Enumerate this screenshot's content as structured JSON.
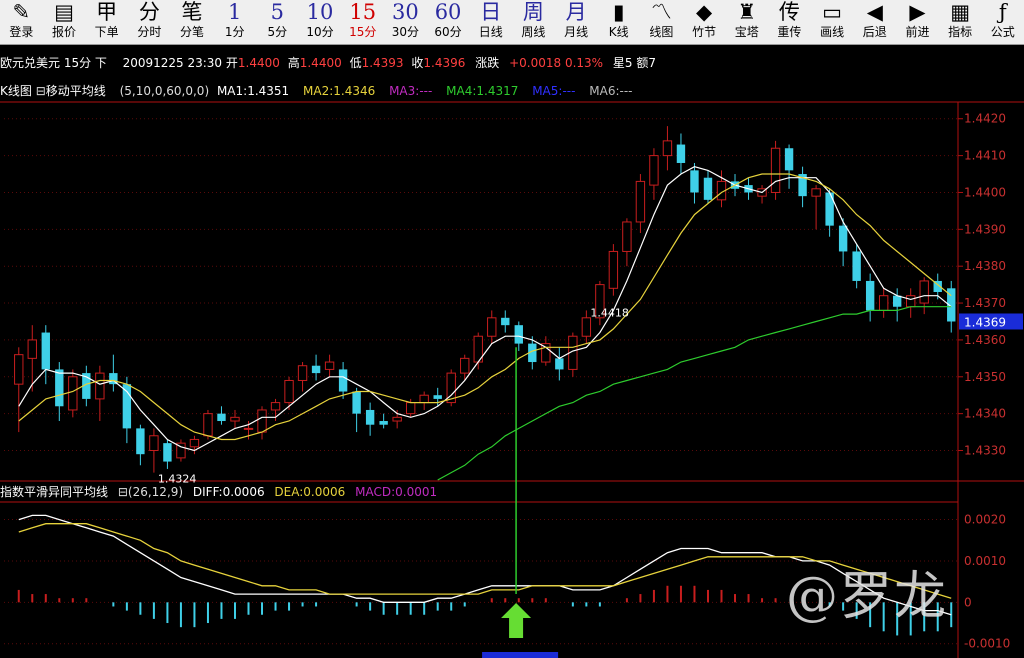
{
  "toolbar": [
    {
      "icon": "✎",
      "label": "登录",
      "name": "login"
    },
    {
      "icon": "▤",
      "label": "报价",
      "name": "quote"
    },
    {
      "icon": "甲",
      "label": "下单",
      "name": "order"
    },
    {
      "icon": "分",
      "label": "分时",
      "name": "intraday"
    },
    {
      "icon": "笔",
      "label": "分笔",
      "name": "tick"
    },
    {
      "icon": "1",
      "label": "1分",
      "name": "1min",
      "num": true
    },
    {
      "icon": "5",
      "label": "5分",
      "name": "5min",
      "num": true
    },
    {
      "icon": "10",
      "label": "10分",
      "name": "10min",
      "num": true
    },
    {
      "icon": "15",
      "label": "15分",
      "name": "15min",
      "num": true,
      "active": true
    },
    {
      "icon": "30",
      "label": "30分",
      "name": "30min",
      "num": true
    },
    {
      "icon": "60",
      "label": "60分",
      "name": "60min",
      "num": true
    },
    {
      "icon": "日",
      "label": "日线",
      "name": "daily",
      "num": true
    },
    {
      "icon": "周",
      "label": "周线",
      "name": "weekly",
      "num": true
    },
    {
      "icon": "月",
      "label": "月线",
      "name": "monthly",
      "num": true
    },
    {
      "icon": "▮",
      "label": "K线",
      "name": "kline"
    },
    {
      "icon": "〽",
      "label": "线图",
      "name": "line"
    },
    {
      "icon": "◆",
      "label": "竹节",
      "name": "bamboo"
    },
    {
      "icon": "♜",
      "label": "宝塔",
      "name": "tower"
    },
    {
      "icon": "传",
      "label": "重传",
      "name": "reload"
    },
    {
      "icon": "▭",
      "label": "画线",
      "name": "draw"
    },
    {
      "icon": "◀",
      "label": "后退",
      "name": "back"
    },
    {
      "icon": "▶",
      "label": "前进",
      "name": "forward"
    },
    {
      "icon": "▦",
      "label": "指标",
      "name": "indicator"
    },
    {
      "icon": "ƒ",
      "label": "公式",
      "name": "formula"
    }
  ],
  "titlebar": {
    "symbol": "欧元兑美元 15分 下",
    "datetime": "20091225 23:30",
    "open_label": "开",
    "open": "1.4400",
    "high_label": "高",
    "high": "1.4400",
    "low_label": "低",
    "low": "1.4393",
    "close_label": "收",
    "close": "1.4396",
    "change_label": "涨跌",
    "change": "+0.0018 0.13%",
    "weekday": "星5",
    "volume": "额7"
  },
  "ma_bar": {
    "kline_label": "K线图",
    "indicator": "移动平均线",
    "params": "(5,10,0,60,0,0)",
    "ma1": "MA1:1.4351",
    "ma2": "MA2:1.4346",
    "ma3": "MA3:---",
    "ma4": "MA4:1.4317",
    "ma5": "MA5:---",
    "ma6": "MA6:---"
  },
  "macd_bar": {
    "indicator": "指数平滑异同平均线",
    "params": "(26,12,9)",
    "diff": "DIFF:0.0006",
    "dea": "DEA:0.0006",
    "macd": "MACD:0.0001"
  },
  "watermark": "@罗龙",
  "colors": {
    "up": "#c81e1e",
    "down": "#3fd0e8",
    "ma1": "#ffffff",
    "ma2": "#e6d23c",
    "ma4": "#2ecc2e",
    "ma3": "#c02cc0",
    "ma5": "#3030ff",
    "ma6": "#bbbbbb",
    "axis": "#b01010",
    "arrow": "#66dd33"
  },
  "chart_data": [
    {
      "type": "candlestick",
      "title": "欧元兑美元 15分",
      "ylim": [
        1.4322,
        1.4424
      ],
      "y_ticks": [
        1.442,
        1.441,
        1.44,
        1.439,
        1.438,
        1.437,
        1.436,
        1.435,
        1.434,
        1.433
      ],
      "last_price_label": "1.4369",
      "annotations": [
        {
          "text": "1.4418",
          "bar": 42
        },
        {
          "text": "1.4324",
          "bar": 10
        }
      ],
      "candles": [
        {
          "o": 1.4348,
          "h": 1.4358,
          "l": 1.4335,
          "c": 1.4356
        },
        {
          "o": 1.4355,
          "h": 1.4364,
          "l": 1.4346,
          "c": 1.436
        },
        {
          "o": 1.4362,
          "h": 1.4364,
          "l": 1.4348,
          "c": 1.4352
        },
        {
          "o": 1.4352,
          "h": 1.4354,
          "l": 1.4338,
          "c": 1.4342
        },
        {
          "o": 1.4341,
          "h": 1.4352,
          "l": 1.4339,
          "c": 1.435
        },
        {
          "o": 1.4351,
          "h": 1.4353,
          "l": 1.4342,
          "c": 1.4344
        },
        {
          "o": 1.4344,
          "h": 1.4353,
          "l": 1.4338,
          "c": 1.4351
        },
        {
          "o": 1.4351,
          "h": 1.4356,
          "l": 1.4346,
          "c": 1.4348
        },
        {
          "o": 1.4348,
          "h": 1.435,
          "l": 1.4332,
          "c": 1.4336
        },
        {
          "o": 1.4336,
          "h": 1.4337,
          "l": 1.4326,
          "c": 1.4329
        },
        {
          "o": 1.433,
          "h": 1.4336,
          "l": 1.4324,
          "c": 1.4334
        },
        {
          "o": 1.4332,
          "h": 1.4333,
          "l": 1.4325,
          "c": 1.4327
        },
        {
          "o": 1.4328,
          "h": 1.4333,
          "l": 1.4327,
          "c": 1.4332
        },
        {
          "o": 1.4331,
          "h": 1.4334,
          "l": 1.4329,
          "c": 1.4333
        },
        {
          "o": 1.4334,
          "h": 1.4341,
          "l": 1.4333,
          "c": 1.434
        },
        {
          "o": 1.434,
          "h": 1.4342,
          "l": 1.4337,
          "c": 1.4338
        },
        {
          "o": 1.4338,
          "h": 1.4341,
          "l": 1.4336,
          "c": 1.4339
        },
        {
          "o": 1.4336,
          "h": 1.4338,
          "l": 1.4333,
          "c": 1.4336
        },
        {
          "o": 1.4335,
          "h": 1.4342,
          "l": 1.4333,
          "c": 1.4341
        },
        {
          "o": 1.4341,
          "h": 1.4344,
          "l": 1.4338,
          "c": 1.4343
        },
        {
          "o": 1.4343,
          "h": 1.435,
          "l": 1.4341,
          "c": 1.4349
        },
        {
          "o": 1.4349,
          "h": 1.4354,
          "l": 1.4346,
          "c": 1.4353
        },
        {
          "o": 1.4353,
          "h": 1.4356,
          "l": 1.4349,
          "c": 1.4351
        },
        {
          "o": 1.4352,
          "h": 1.4356,
          "l": 1.435,
          "c": 1.4354
        },
        {
          "o": 1.4352,
          "h": 1.4354,
          "l": 1.4344,
          "c": 1.4346
        },
        {
          "o": 1.4346,
          "h": 1.4347,
          "l": 1.4335,
          "c": 1.434
        },
        {
          "o": 1.4341,
          "h": 1.4343,
          "l": 1.4334,
          "c": 1.4337
        },
        {
          "o": 1.4338,
          "h": 1.434,
          "l": 1.4336,
          "c": 1.4337
        },
        {
          "o": 1.4338,
          "h": 1.4341,
          "l": 1.4336,
          "c": 1.4339
        },
        {
          "o": 1.434,
          "h": 1.4344,
          "l": 1.4339,
          "c": 1.4343
        },
        {
          "o": 1.4343,
          "h": 1.4346,
          "l": 1.4341,
          "c": 1.4345
        },
        {
          "o": 1.4345,
          "h": 1.4347,
          "l": 1.4342,
          "c": 1.4344
        },
        {
          "o": 1.4343,
          "h": 1.4352,
          "l": 1.4342,
          "c": 1.4351
        },
        {
          "o": 1.4351,
          "h": 1.4356,
          "l": 1.4349,
          "c": 1.4355
        },
        {
          "o": 1.4354,
          "h": 1.4362,
          "l": 1.4352,
          "c": 1.4361
        },
        {
          "o": 1.4361,
          "h": 1.4368,
          "l": 1.4359,
          "c": 1.4366
        },
        {
          "o": 1.4366,
          "h": 1.4368,
          "l": 1.4362,
          "c": 1.4364
        },
        {
          "o": 1.4364,
          "h": 1.4365,
          "l": 1.4357,
          "c": 1.4359
        },
        {
          "o": 1.4359,
          "h": 1.4361,
          "l": 1.4352,
          "c": 1.4354
        },
        {
          "o": 1.4354,
          "h": 1.4361,
          "l": 1.4353,
          "c": 1.4359
        },
        {
          "o": 1.4355,
          "h": 1.4358,
          "l": 1.4349,
          "c": 1.4352
        },
        {
          "o": 1.4352,
          "h": 1.4362,
          "l": 1.435,
          "c": 1.4361
        },
        {
          "o": 1.4361,
          "h": 1.4368,
          "l": 1.4359,
          "c": 1.4366
        },
        {
          "o": 1.4366,
          "h": 1.4376,
          "l": 1.4364,
          "c": 1.4375
        },
        {
          "o": 1.4374,
          "h": 1.4386,
          "l": 1.4372,
          "c": 1.4384
        },
        {
          "o": 1.4384,
          "h": 1.4393,
          "l": 1.438,
          "c": 1.4392
        },
        {
          "o": 1.4392,
          "h": 1.4405,
          "l": 1.4389,
          "c": 1.4403
        },
        {
          "o": 1.4402,
          "h": 1.4412,
          "l": 1.4398,
          "c": 1.441
        },
        {
          "o": 1.441,
          "h": 1.4418,
          "l": 1.4406,
          "c": 1.4414
        },
        {
          "o": 1.4413,
          "h": 1.4416,
          "l": 1.4405,
          "c": 1.4408
        },
        {
          "o": 1.4406,
          "h": 1.4408,
          "l": 1.4397,
          "c": 1.44
        },
        {
          "o": 1.4404,
          "h": 1.4406,
          "l": 1.4397,
          "c": 1.4398
        },
        {
          "o": 1.4398,
          "h": 1.4406,
          "l": 1.4396,
          "c": 1.4403
        },
        {
          "o": 1.4403,
          "h": 1.4405,
          "l": 1.4399,
          "c": 1.4401
        },
        {
          "o": 1.4402,
          "h": 1.4404,
          "l": 1.4398,
          "c": 1.44
        },
        {
          "o": 1.4399,
          "h": 1.4402,
          "l": 1.4397,
          "c": 1.4401
        },
        {
          "o": 1.44,
          "h": 1.4414,
          "l": 1.4398,
          "c": 1.4412
        },
        {
          "o": 1.4412,
          "h": 1.4413,
          "l": 1.4401,
          "c": 1.4406
        },
        {
          "o": 1.4405,
          "h": 1.4407,
          "l": 1.4396,
          "c": 1.4399
        },
        {
          "o": 1.4399,
          "h": 1.4402,
          "l": 1.439,
          "c": 1.4401
        },
        {
          "o": 1.44,
          "h": 1.4401,
          "l": 1.4388,
          "c": 1.4391
        },
        {
          "o": 1.4391,
          "h": 1.4393,
          "l": 1.438,
          "c": 1.4384
        },
        {
          "o": 1.4384,
          "h": 1.4386,
          "l": 1.4374,
          "c": 1.4376
        },
        {
          "o": 1.4376,
          "h": 1.4378,
          "l": 1.4365,
          "c": 1.4368
        },
        {
          "o": 1.4368,
          "h": 1.4374,
          "l": 1.4366,
          "c": 1.4372
        },
        {
          "o": 1.4372,
          "h": 1.4374,
          "l": 1.4365,
          "c": 1.4369
        },
        {
          "o": 1.4369,
          "h": 1.4374,
          "l": 1.4366,
          "c": 1.4372
        },
        {
          "o": 1.437,
          "h": 1.4377,
          "l": 1.4367,
          "c": 1.4376
        },
        {
          "o": 1.4376,
          "h": 1.4378,
          "l": 1.4371,
          "c": 1.4373
        },
        {
          "o": 1.4374,
          "h": 1.4376,
          "l": 1.4362,
          "c": 1.4365
        }
      ],
      "ma_series": [
        {
          "name": "MA1",
          "values": [
            1.4342,
            1.4348,
            1.4352,
            1.4351,
            1.4351,
            1.435,
            1.4348,
            1.4349,
            1.4346,
            1.4341,
            1.4337,
            1.4333,
            1.4331,
            1.433,
            1.4332,
            1.4334,
            1.4336,
            1.4337,
            1.4339,
            1.4339,
            1.4342,
            1.4345,
            1.4348,
            1.435,
            1.435,
            1.4348,
            1.4346,
            1.4343,
            1.434,
            1.4339,
            1.434,
            1.4342,
            1.4345,
            1.4349,
            1.4354,
            1.4359,
            1.4361,
            1.4361,
            1.436,
            1.4358,
            1.4355,
            1.4357,
            1.4358,
            1.4362,
            1.4368,
            1.4376,
            1.4385,
            1.4394,
            1.4402,
            1.4405,
            1.4407,
            1.4406,
            1.4404,
            1.4402,
            1.4401,
            1.44,
            1.4403,
            1.4404,
            1.4404,
            1.4404,
            1.44,
            1.4392,
            1.4386,
            1.438,
            1.4374,
            1.4372,
            1.4371,
            1.4372,
            1.4372,
            1.4369
          ]
        },
        {
          "name": "MA2",
          "values": [
            1.4338,
            1.4341,
            1.4344,
            1.4345,
            1.4346,
            1.4348,
            1.4349,
            1.4349,
            1.4348,
            1.4346,
            1.4343,
            1.434,
            1.4337,
            1.4335,
            1.4334,
            1.4333,
            1.4333,
            1.4334,
            1.4335,
            1.4337,
            1.4338,
            1.434,
            1.4342,
            1.4344,
            1.4345,
            1.4346,
            1.4346,
            1.4345,
            1.4344,
            1.4343,
            1.4343,
            1.4343,
            1.4344,
            1.4345,
            1.4347,
            1.435,
            1.4352,
            1.4355,
            1.4357,
            1.4358,
            1.4358,
            1.4358,
            1.4359,
            1.436,
            1.4363,
            1.4367,
            1.4371,
            1.4377,
            1.4383,
            1.4389,
            1.4394,
            1.4397,
            1.44,
            1.4402,
            1.4404,
            1.4405,
            1.4405,
            1.4405,
            1.4404,
            1.4403,
            1.4401,
            1.4398,
            1.4394,
            1.4391,
            1.4387,
            1.4384,
            1.4381,
            1.4378,
            1.4375,
            1.4372
          ]
        },
        {
          "name": "MA4",
          "values": [
            null,
            null,
            null,
            null,
            null,
            null,
            null,
            null,
            null,
            null,
            null,
            null,
            null,
            null,
            null,
            null,
            null,
            null,
            null,
            null,
            null,
            null,
            null,
            null,
            null,
            null,
            null,
            null,
            null,
            null,
            null,
            1.4322,
            1.4324,
            1.4326,
            1.4329,
            1.4331,
            1.4334,
            1.4336,
            1.4338,
            1.434,
            1.4342,
            1.4343,
            1.4345,
            1.4346,
            1.4348,
            1.4349,
            1.435,
            1.4351,
            1.4352,
            1.4354,
            1.4355,
            1.4356,
            1.4357,
            1.4358,
            1.436,
            1.4361,
            1.4362,
            1.4363,
            1.4364,
            1.4365,
            1.4366,
            1.4367,
            1.4367,
            1.4368,
            1.4368,
            1.4368,
            1.4369,
            1.4369,
            1.4369,
            1.4369
          ]
        }
      ]
    },
    {
      "type": "bar",
      "title": "MACD",
      "ylim": [
        -0.0012,
        0.0024
      ],
      "y_ticks": [
        0.002,
        0.001,
        0,
        -0.001
      ],
      "y_tick_labels": [
        "0.0020",
        "0.0010",
        "0",
        "-0.0010"
      ],
      "macd_hist": [
        0.0003,
        0.0002,
        0.0002,
        0.0001,
        0.0001,
        0.0001,
        0,
        -0.0001,
        -0.0002,
        -0.0003,
        -0.0004,
        -0.0005,
        -0.0006,
        -0.0006,
        -0.0005,
        -0.0004,
        -0.0004,
        -0.0003,
        -0.0003,
        -0.0002,
        -0.0002,
        -0.0001,
        -0.0001,
        0,
        0,
        -0.0001,
        -0.0002,
        -0.0003,
        -0.0003,
        -0.0003,
        -0.0003,
        -0.0002,
        -0.0002,
        -0.0001,
        0,
        0.0001,
        0.0001,
        0.0001,
        0.0001,
        0.0001,
        0,
        -0.0001,
        -0.0001,
        -0.0001,
        0,
        0.0001,
        0.0002,
        0.0003,
        0.0004,
        0.0004,
        0.0004,
        0.0003,
        0.0003,
        0.0002,
        0.0002,
        0.0001,
        0.0001,
        0,
        0,
        0,
        -0.0001,
        -0.0002,
        -0.0004,
        -0.0006,
        -0.0007,
        -0.0008,
        -0.0008,
        -0.0007,
        -0.0007,
        -0.0006
      ],
      "diff": [
        0.002,
        0.0021,
        0.0021,
        0.002,
        0.0019,
        0.0018,
        0.0017,
        0.0016,
        0.0014,
        0.0012,
        0.001,
        0.0008,
        0.0006,
        0.0005,
        0.0004,
        0.0003,
        0.0002,
        0.0002,
        0.0002,
        0.0002,
        0.0002,
        0.0002,
        0.0002,
        0.0002,
        0.0002,
        0.0001,
        0.0001,
        0,
        0,
        0,
        0,
        0.0001,
        0.0001,
        0.0002,
        0.0003,
        0.0004,
        0.0004,
        0.0004,
        0.0004,
        0.0004,
        0.0004,
        0.0003,
        0.0003,
        0.0003,
        0.0004,
        0.0006,
        0.0008,
        0.001,
        0.0012,
        0.0013,
        0.0013,
        0.0013,
        0.0012,
        0.0012,
        0.0012,
        0.0012,
        0.0011,
        0.0011,
        0.001,
        0.001,
        0.0009,
        0.0007,
        0.0005,
        0.0003,
        0.0001,
        0,
        -0.0001,
        -0.0002,
        -0.0002,
        -0.0003
      ],
      "dea": [
        0.0017,
        0.0018,
        0.0019,
        0.0019,
        0.0019,
        0.0019,
        0.0018,
        0.0017,
        0.0016,
        0.0015,
        0.0013,
        0.0012,
        0.001,
        0.0009,
        0.0008,
        0.0007,
        0.0006,
        0.0005,
        0.0004,
        0.0004,
        0.0003,
        0.0003,
        0.0003,
        0.0002,
        0.0002,
        0.0002,
        0.0002,
        0.0002,
        0.0002,
        0.0002,
        0.0002,
        0.0002,
        0.0002,
        0.0002,
        0.0002,
        0.0003,
        0.0003,
        0.0003,
        0.0004,
        0.0004,
        0.0004,
        0.0004,
        0.0004,
        0.0004,
        0.0004,
        0.0005,
        0.0006,
        0.0007,
        0.0008,
        0.0009,
        0.001,
        0.0011,
        0.0011,
        0.0011,
        0.0011,
        0.0011,
        0.0011,
        0.0011,
        0.0011,
        0.001,
        0.001,
        0.0009,
        0.0008,
        0.0007,
        0.0006,
        0.0005,
        0.0004,
        0.0003,
        0.0002,
        0.0001
      ]
    }
  ]
}
